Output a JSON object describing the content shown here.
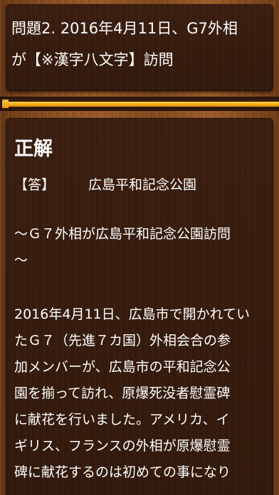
{
  "question": {
    "text": "問題2. 2016年4月11日、G7外相\nが【※漢字八文字】訪問"
  },
  "progress": {
    "value_percent": 100,
    "color": "#f1a814"
  },
  "result": {
    "heading": "正解",
    "answer_label": "【答】",
    "answer_value": "広島平和記念公園",
    "subtitle": "～Ｇ７外相が広島平和記念公園訪問\n～",
    "body": "2016年4月11日、広島市で開かれてい\nたＧ７（先進７カ国）外相会合の参\n加メンバーが、広島市の平和記念公\n園を揃って訪れ、原爆死没者慰霊碑\nに献花を行いました。アメリカ、イ\nギリス、フランスの外相が原爆慰霊\n碑に献花するのは初めての事になり"
  }
}
